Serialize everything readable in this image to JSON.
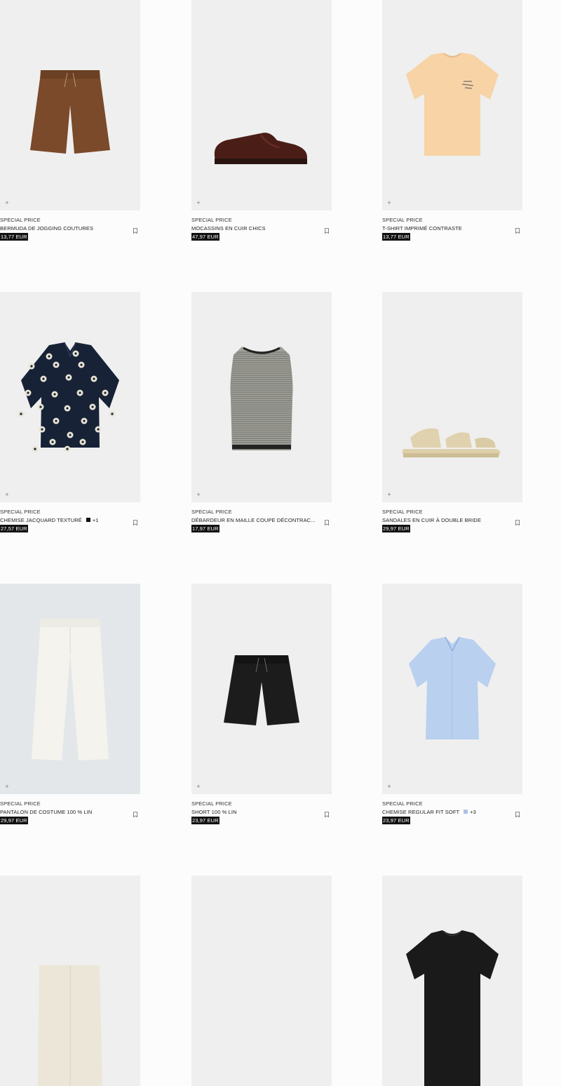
{
  "products": [
    {
      "tag": "SPECIAL PRICE",
      "name": "BERMUDA DE JOGGING COUTURES",
      "price": "13,77 EUR",
      "image": "brown-shorts"
    },
    {
      "tag": "SPECIAL PRICE",
      "name": "MOCASSINS EN CUIR CHICS",
      "price": "47,97 EUR",
      "image": "loafer"
    },
    {
      "tag": "SPECIAL PRICE",
      "name": "T-SHIRT IMPRIMÉ CONTRASTE",
      "price": "13,77 EUR",
      "image": "peach-tshirt"
    },
    {
      "tag": "SPECIAL PRICE",
      "name": "CHEMISE JACQUARD TEXTURÉ",
      "more": "+1",
      "swatch": "#111111",
      "price": "27,57 EUR",
      "image": "floral-shirt"
    },
    {
      "tag": "SPECIAL PRICE",
      "name": "DÉBARDEUR EN MAILLE COUPE DÉCONTRAC...",
      "price": "17,97 EUR",
      "image": "knit-tank"
    },
    {
      "tag": "SPECIAL PRICE",
      "name": "SANDALES EN CUIR À DOUBLE BRIDE",
      "price": "29,97 EUR",
      "image": "sandal"
    },
    {
      "tag": "SPECIAL PRICE",
      "name": "PANTALON DE COSTUME 100 % LIN",
      "price": "29,97 EUR",
      "image": "linen-trousers"
    },
    {
      "tag": "SPECIAL PRICE",
      "name": "SHORT 100 % LIN",
      "price": "23,97 EUR",
      "image": "black-shorts"
    },
    {
      "tag": "SPECIAL PRICE",
      "name": "CHEMISE REGULAR FIT SOFT",
      "more": "+3",
      "swatch": "#a9c4e4",
      "price": "23,97 EUR",
      "image": "blue-shirt"
    },
    {
      "image": "ecru-shorts"
    },
    {
      "image": "empty"
    },
    {
      "image": "black-tee"
    }
  ],
  "ui": {
    "add_label": "+",
    "bookmark_icon": "bookmark-icon"
  }
}
